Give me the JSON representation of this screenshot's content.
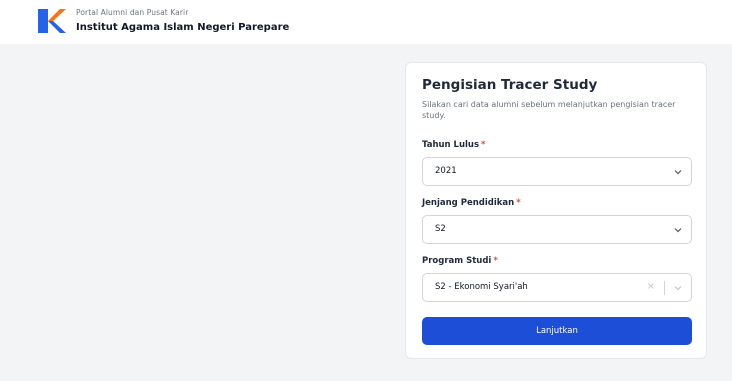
{
  "header": {
    "subtitle": "Portal Alumni dan Pusat Karir",
    "title": "Institut Agama Islam Negeri Parepare",
    "logo_icon": "k-logo-icon",
    "logo_colors": {
      "blue": "#2563eb",
      "orange": "#f97316"
    }
  },
  "form": {
    "title": "Pengisian Tracer Study",
    "description": "Silakan cari data alumni sebelum melanjutkan pengisian tracer study.",
    "required_mark": "*",
    "fields": [
      {
        "label": "Tahun Lulus",
        "value": "2021"
      },
      {
        "label": "Jenjang Pendidikan",
        "value": "S2"
      },
      {
        "label": "Program Studi",
        "value": "S2 - Ekonomi Syari'ah",
        "clearable": true
      }
    ],
    "clear_glyph": "×",
    "submit_label": "Lanjutkan"
  },
  "colors": {
    "primary": "#1d4ed8",
    "required": "#ef4444",
    "background": "#f3f4f6"
  }
}
